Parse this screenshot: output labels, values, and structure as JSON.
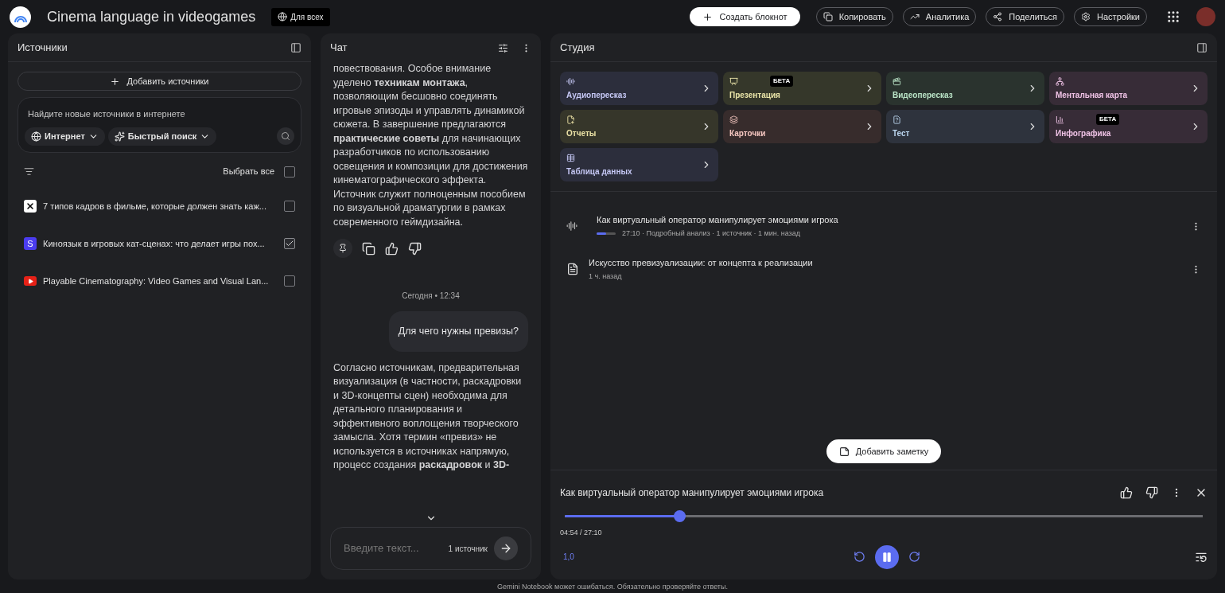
{
  "header": {
    "title": "Cinema language in videogames",
    "visibility": "Для всех",
    "create_button": "Создать блокнот",
    "actions": [
      {
        "kind": "copy",
        "label": "Копировать"
      },
      {
        "kind": "analytics",
        "label": "Аналитика"
      },
      {
        "kind": "share",
        "label": "Поделиться"
      },
      {
        "kind": "settings",
        "label": "Настройки"
      }
    ]
  },
  "sources": {
    "title": "Источники",
    "add_button": "Добавить источники",
    "search": {
      "placeholder": "Найдите новые источники в интернете",
      "scope": "Интернет",
      "mode": "Быстрый поиск"
    },
    "select_all": {
      "label": "Выбрать все",
      "checked": false
    },
    "items": [
      {
        "kind": "capcut",
        "title": "7 типов кадров в фильме, которые должен знать каж...",
        "checked": false
      },
      {
        "kind": "letter",
        "icon_text": "S",
        "title": "Киноязык в игровых кат-сценах: что делает игры пох...",
        "checked": true
      },
      {
        "kind": "youtube",
        "title": "Playable Cinematography: Video Games and Visual Lan...",
        "checked": false
      }
    ]
  },
  "chat": {
    "title": "Чат",
    "messages": [
      {
        "kind": "answer",
        "text": "повествования. Особое внимание уделено **техникам монтажа**, позволяющим бесшовно соединять игровые эпизоды и управлять динамикой сюжета. В завершение предлагаются **практические советы** для начинающих разработчиков по использованию освещения и композиции для достижения кинематографического эффекта. Источник служит полноценным пособием по визуальной драматургии в рамках современного геймдизайна."
      },
      {
        "kind": "actions"
      },
      {
        "kind": "date",
        "text": "Сегодня • 12:34"
      },
      {
        "kind": "question",
        "text": "Для чего нужны превизы?"
      },
      {
        "kind": "answer",
        "text": "Согласно источникам, предварительная визуализация (в частности, раскадровки и 3D-концепты сцен) необходима для детального планирования и эффективного воплощения творческого замысла. Хотя термин «превиз» не используется в источниках напрямую, процесс создания **раскадровок** и **3D-**"
      }
    ],
    "input": {
      "placeholder": "Введите текст...",
      "source_count": "1 источник"
    }
  },
  "studio": {
    "title": "Студия",
    "tiles": [
      {
        "kind": "audio",
        "label": "Аудиопересказ",
        "color": "#c6c8f5"
      },
      {
        "kind": "slides",
        "label": "Презентация",
        "badge": "БЕТА",
        "color": "#e9e4a8"
      },
      {
        "kind": "video",
        "label": "Видеопересказ",
        "color": "#b9e3c6"
      },
      {
        "kind": "mindmap",
        "label": "Ментальная карта",
        "color": "#f0c3e6"
      },
      {
        "kind": "report",
        "label": "Отчеты",
        "color": "#ece3a6"
      },
      {
        "kind": "cards",
        "label": "Карточки",
        "color": "#f4c6c0"
      },
      {
        "kind": "quiz",
        "label": "Тест",
        "color": "#bcd7f0"
      },
      {
        "kind": "infographic",
        "label": "Инфографика",
        "badge": "БЕТА",
        "color": "#f0c3e6"
      },
      {
        "kind": "table",
        "label": "Таблица данных",
        "color": "#c6c8f5"
      }
    ],
    "notes": [
      {
        "kind": "audio",
        "title": "Как виртуальный оператор манипулирует эмоциями игрока",
        "meta": "27:10 · Подробный анализ · 1 источник · 1 мин. назад",
        "level": 0.5
      },
      {
        "kind": "note",
        "title": "Искусство превизуализации: от концепта к реализации",
        "meta": "1 ч. назад"
      }
    ],
    "add_note": "Добавить заметку",
    "player": {
      "title": "Как виртуальный оператор манипулирует эмоциями игрока",
      "level": 0.18,
      "time": "04:54 / 27:10",
      "speed": "1,0",
      "playing": true
    }
  },
  "footer": "Gemini Notebook может ошибаться. Обязательно проверяйте ответы."
}
